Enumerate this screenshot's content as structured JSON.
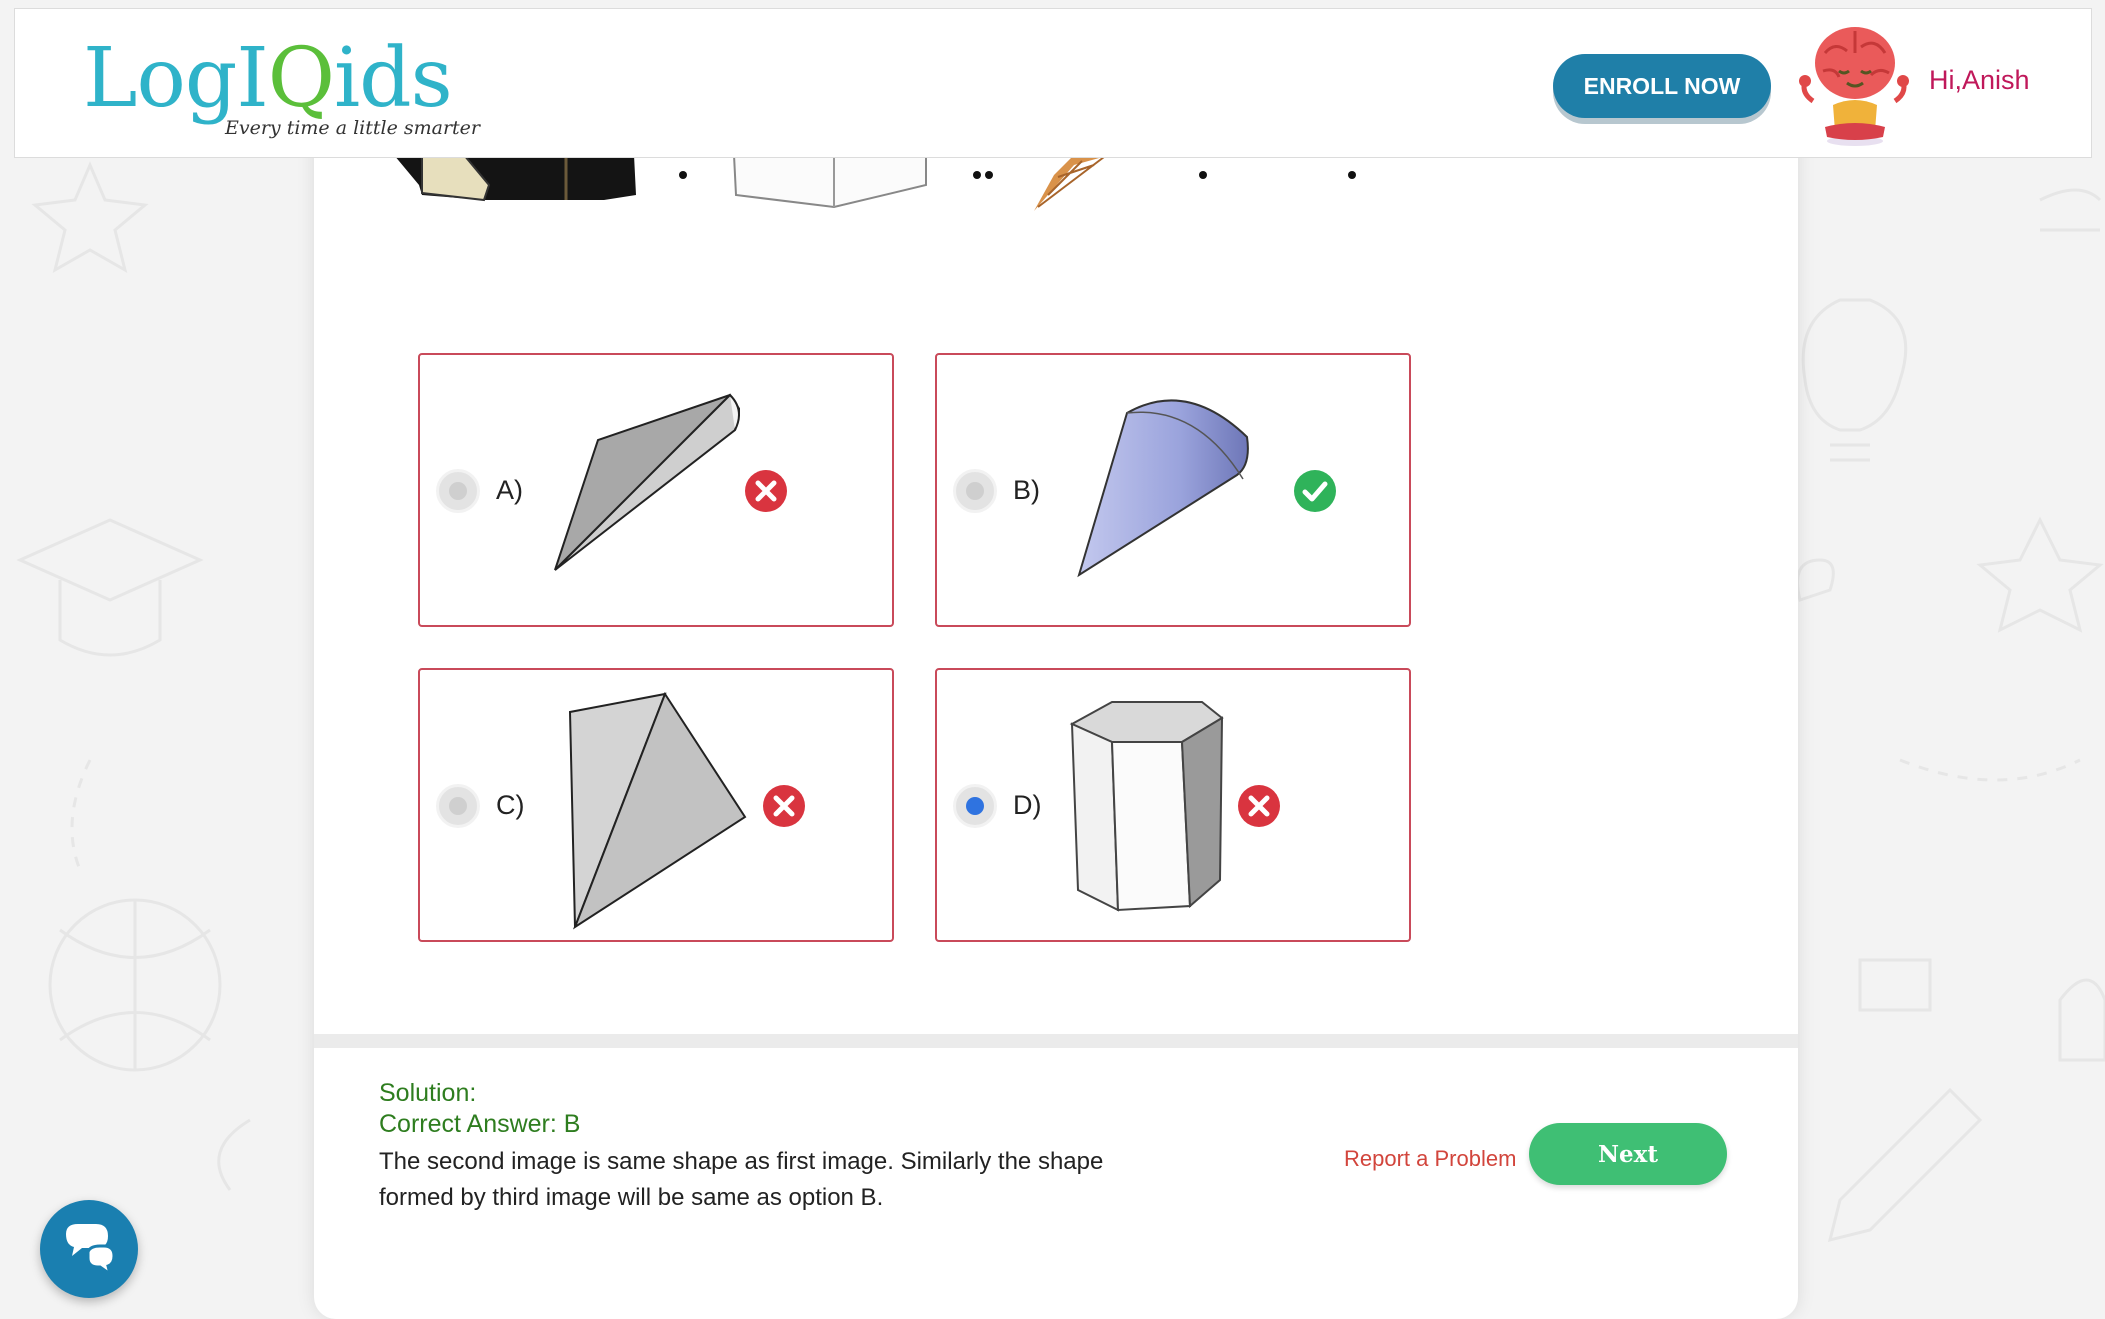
{
  "header": {
    "logo": {
      "text_start": "LogI",
      "text_q": "Q",
      "text_end": "ids",
      "tagline": "Every time a little smarter"
    },
    "enroll_label": "ENROLL NOW",
    "greeting": "Hi,Anish"
  },
  "question": {
    "options": [
      {
        "label": "A)",
        "selected": false,
        "result": "wrong"
      },
      {
        "label": "B)",
        "selected": false,
        "result": "correct"
      },
      {
        "label": "C)",
        "selected": false,
        "result": "wrong"
      },
      {
        "label": "D)",
        "selected": true,
        "result": "wrong"
      }
    ]
  },
  "solution": {
    "title": "Solution:",
    "answer": "Correct Answer: B",
    "text": "The second image is same shape as first image. Similarly the shape formed by third image will be same as option B."
  },
  "actions": {
    "report_label": "Report a Problem",
    "next_label": "Next"
  },
  "colors": {
    "brand_teal": "#2fb3c9",
    "brand_green": "#5bbf3a",
    "enroll_blue": "#1f7fa8",
    "greeting_pink": "#c0185a",
    "option_border": "#c94a5a",
    "correct_green": "#2fb35a",
    "wrong_red": "#d9343f",
    "next_green": "#3fbf74",
    "solution_green": "#2e7d1f"
  },
  "icons": {
    "chat": "chat-bubbles-icon",
    "correct": "check-circle-icon",
    "wrong": "x-circle-icon"
  }
}
